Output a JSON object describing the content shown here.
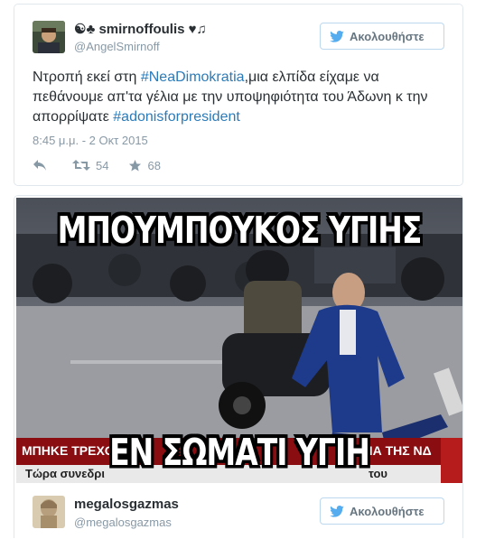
{
  "tweet1": {
    "display_name": "☯♣ smirnoffoulis ♥♫",
    "handle": "@AngelSmirnoff",
    "follow_label": "Ακολουθήστε",
    "text_parts": {
      "p1": "Ντροπή εκεί στη ",
      "hashtag1": "#NeaDimokratia",
      "p2": ",μια ελπίδα είχαμε να πεθάνουμε απ'τα γέλια με την υποψηφιότητα του Άδωνη κ την απορρίψατε ",
      "hashtag2": "#adonisforpresident"
    },
    "timestamp": "8:45 μ.μ. - 2 Οκτ 2015",
    "retweets": "54",
    "likes": "68"
  },
  "meme": {
    "top_caption": "ΜΠΟΥΜΠΟΥΚΟΣ ΥΓΙΗΣ",
    "bottom_caption": "ΕΝ ΣΩΜΑΤΙ ΥΓΙΗ",
    "ticker_line1": "ΜΠΗΚΕ ΤΡΕΧΟ",
    "ticker_line1b": "ΡΕΙΑ ΤΗΣ ΝΔ",
    "ticker_line2": "Τώρα συνεδρι",
    "ticker_line2b": "του"
  },
  "tweet2": {
    "display_name": "megalosgazmas",
    "handle": "@megalosgazmas",
    "follow_label": "Ακολουθήστε"
  },
  "colors": {
    "link": "#2b7bb9",
    "muted": "#8899a6",
    "border": "#e1e8ed",
    "twitter_blue": "#55acee"
  },
  "icons": [
    "twitter-bird-icon",
    "reply-icon",
    "retweet-icon",
    "like-star-icon"
  ]
}
